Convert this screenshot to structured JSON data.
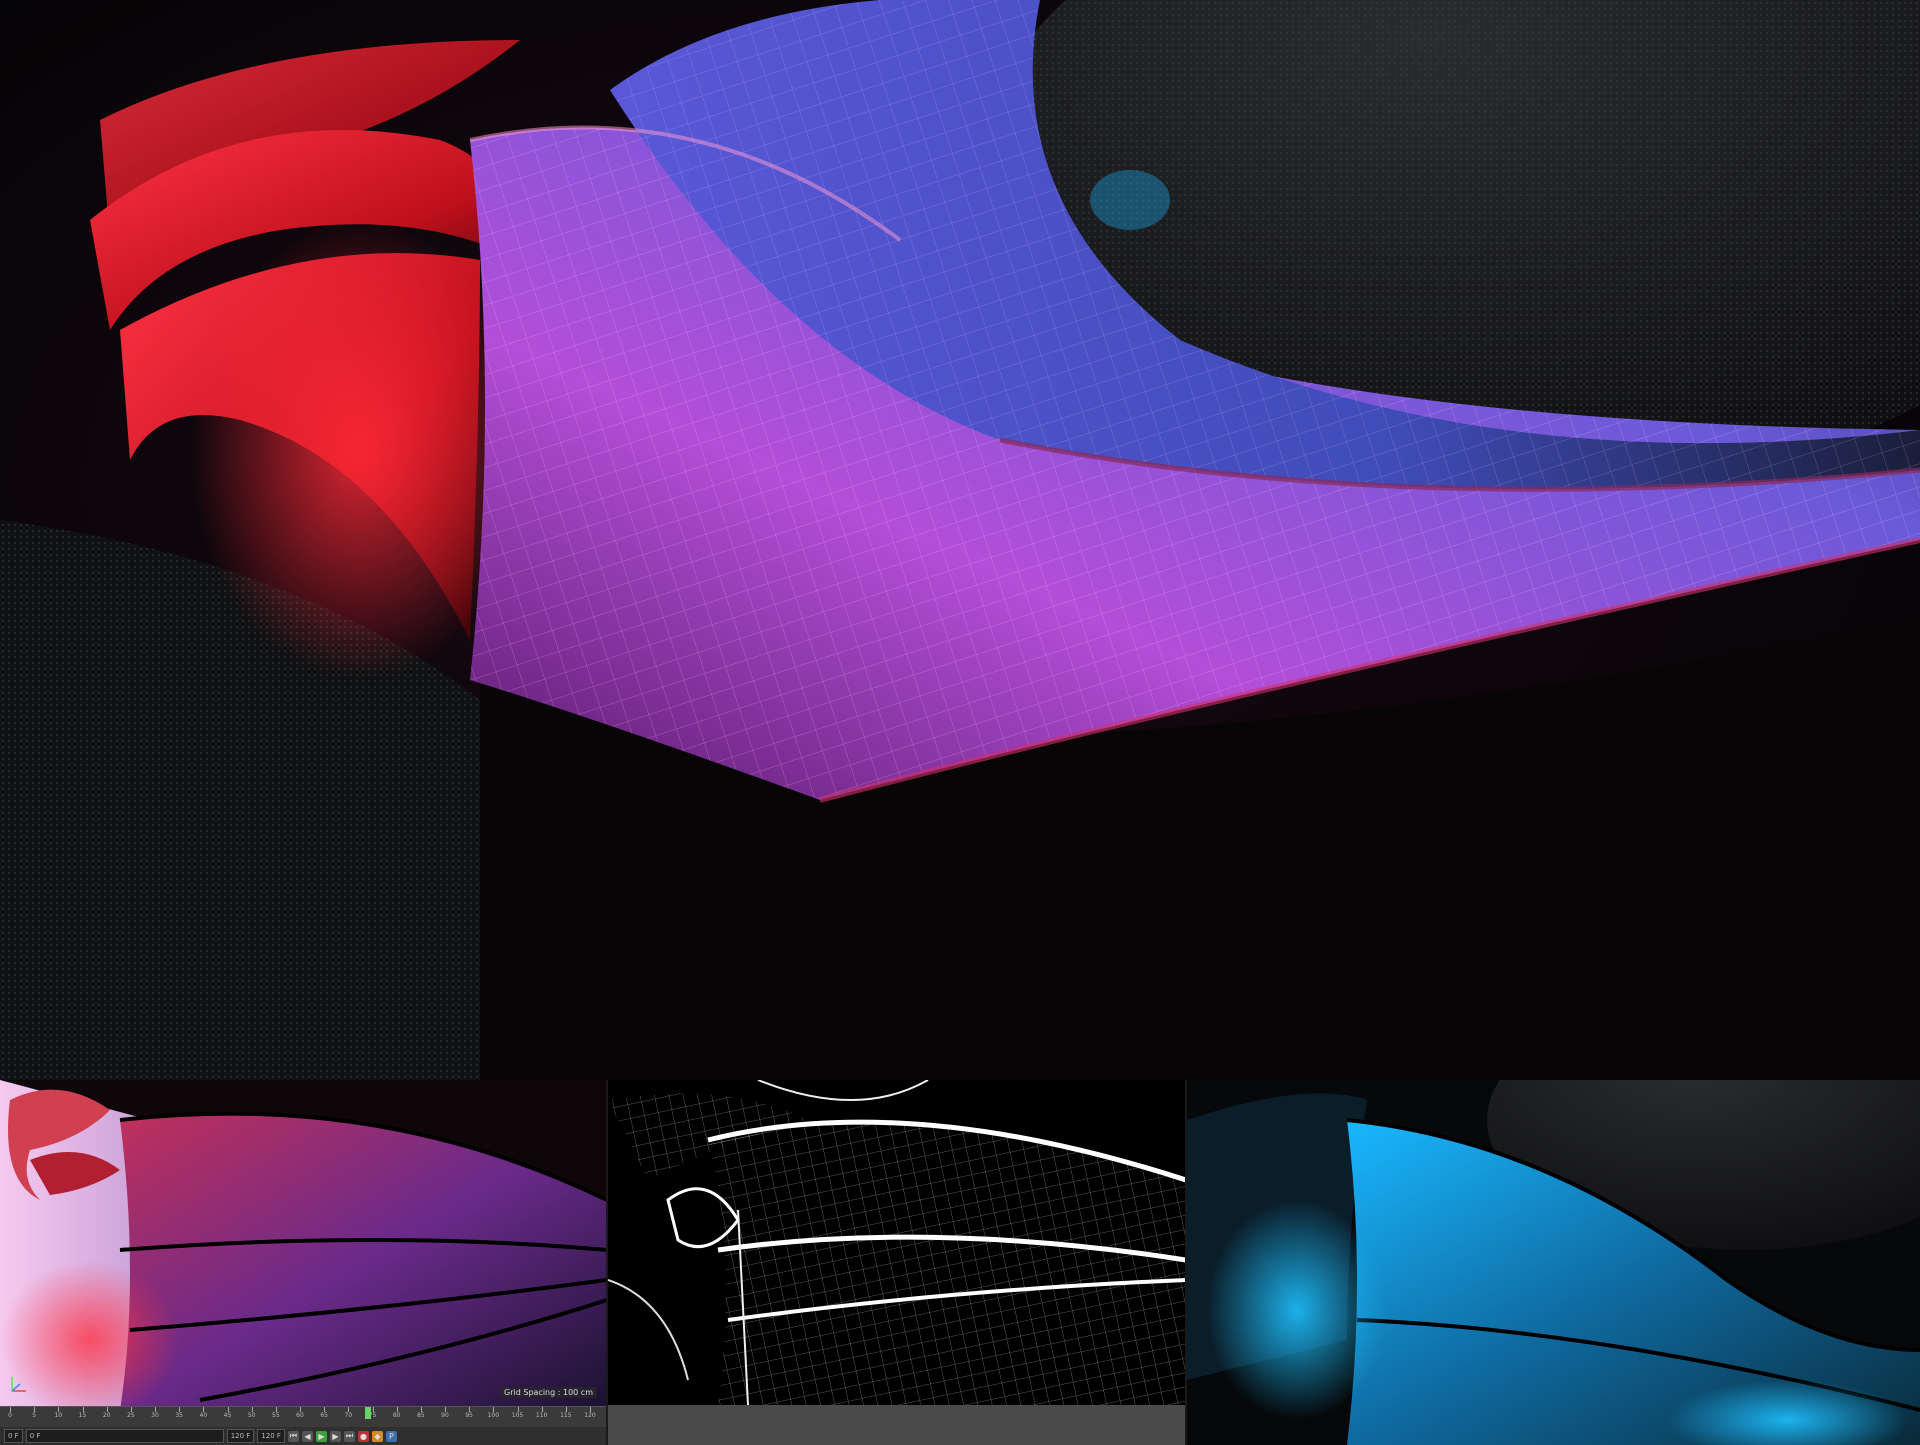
{
  "viewport": {
    "grid_spacing_label": "Grid Spacing : 100 cm"
  },
  "timeline": {
    "ticks": [
      "0",
      "5",
      "10",
      "15",
      "20",
      "25",
      "30",
      "35",
      "40",
      "45",
      "50",
      "55",
      "60",
      "65",
      "70",
      "75",
      "80",
      "85",
      "90",
      "95",
      "100",
      "105",
      "110",
      "115",
      "120"
    ],
    "current_frame": "0 F",
    "start_field": "0 F",
    "end_field": "120 F",
    "end_field_2": "120 F",
    "right_field": "78 F"
  },
  "colors": {
    "red": "#ff2a38",
    "violet": "#9a4ad8",
    "blue": "#4856c8",
    "cyan": "#19b8ff"
  },
  "icons": [
    "rewind-icon",
    "step-back-icon",
    "play-icon",
    "step-forward-icon",
    "fast-forward-icon",
    "record-icon",
    "keyframe-icon"
  ]
}
